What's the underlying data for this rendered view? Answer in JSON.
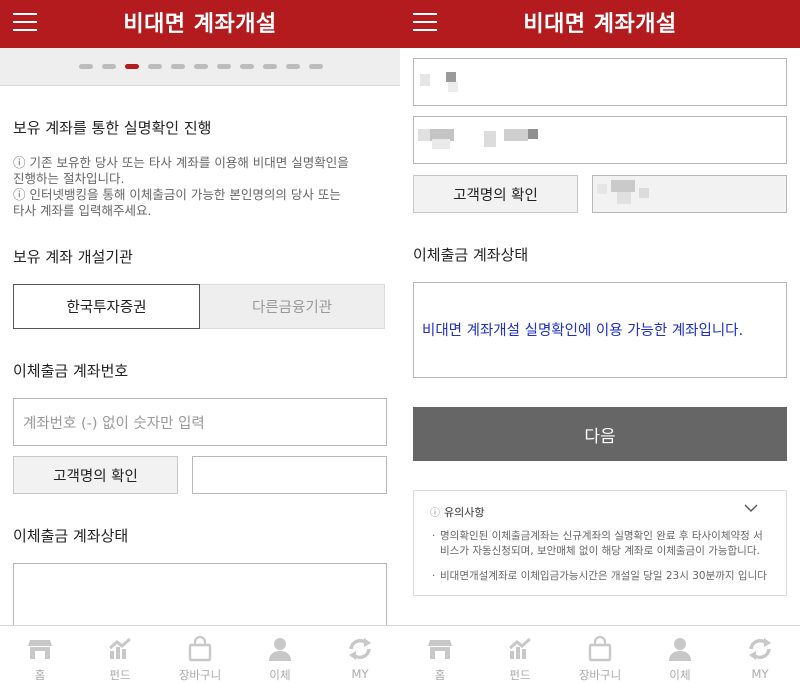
{
  "colors": {
    "brand": "#b31b1f",
    "link": "#1f2fc7",
    "disabled_button": "#666666"
  },
  "header": {
    "title": "비대면 계좌개설",
    "menu_icon": "hamburger-icon"
  },
  "progress": {
    "total_steps": 11,
    "current_step": 3
  },
  "left": {
    "section_own_account": {
      "title": "보유 계좌를 통한 실명확인 진행",
      "notices": [
        "ⓘ 기존 보유한 당사 또는 타사 계좌를 이용해 비대면 실명확인을",
        "진행하는 절차입니다.",
        "ⓘ 인터넷뱅킹을 통해 이체출금이 가능한 본인명의의 당사 또는",
        "타사 계좌를 입력해주세요."
      ]
    },
    "section_institution": {
      "title": "보유 계좌 개설기관",
      "options": [
        {
          "label": "한국투자증권",
          "selected": true
        },
        {
          "label": "다른금융기관",
          "selected": false
        }
      ]
    },
    "section_account_number": {
      "title": "이체출금 계좌번호",
      "input_placeholder": "계좌번호 (-) 없이 숫자만 입력",
      "input_value": "",
      "confirm_button": "고객명의 확인",
      "name_value": ""
    },
    "section_status": {
      "title": "이체출금 계좌상태",
      "message": ""
    }
  },
  "right": {
    "confirm_button": "고객명의 확인",
    "status_title": "이체출금 계좌상태",
    "status_message": "비대면 계좌개설 실명확인에 이용 가능한 계좌입니다.",
    "next_button": "다음",
    "caution": {
      "icon": "ⓘ",
      "title": "유의사항",
      "items": [
        {
          "bullet": "·",
          "text": "명의확인된 이체출금계좌는 신규계좌의 실명확인 완료 후 타사이체약정 서비스가 자동신청되며, 보안매체 없이 해당 계좌로 이체출금이 가능합니다."
        },
        {
          "bullet": "·",
          "text": "비대면개설계좌로 이체입금가능시간은 개설일 당일 23시 30분까지 입니다"
        }
      ]
    }
  },
  "tabs": [
    {
      "label": "홈",
      "icon": "store-icon"
    },
    {
      "label": "펀드",
      "icon": "chart-icon"
    },
    {
      "label": "장바구니",
      "icon": "shopping-bag-icon"
    },
    {
      "label": "이체",
      "icon": "user-icon"
    },
    {
      "label": "MY",
      "icon": "refresh-icon"
    }
  ]
}
